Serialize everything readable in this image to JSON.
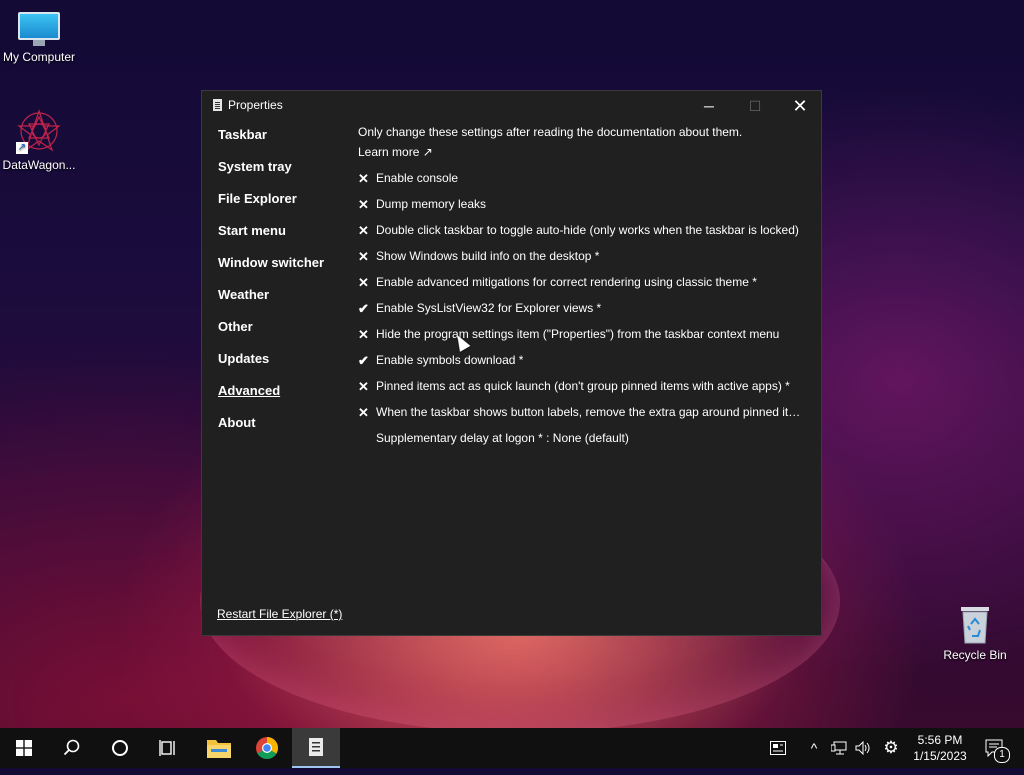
{
  "desktop": {
    "icons": [
      {
        "label": "My Computer"
      },
      {
        "label": "DataWagon..."
      },
      {
        "label": "Recycle Bin"
      }
    ]
  },
  "window": {
    "title": "Properties",
    "controls": {
      "minimize": "─",
      "maximize": "☐",
      "close": "✕"
    },
    "nav": [
      {
        "label": "Taskbar",
        "active": false
      },
      {
        "label": "System tray",
        "active": false
      },
      {
        "label": "File Explorer",
        "active": false
      },
      {
        "label": "Start menu",
        "active": false
      },
      {
        "label": "Window switcher",
        "active": false
      },
      {
        "label": "Weather",
        "active": false
      },
      {
        "label": "Other",
        "active": false
      },
      {
        "label": "Updates",
        "active": false
      },
      {
        "label": "Advanced",
        "active": true
      },
      {
        "label": "About",
        "active": false
      }
    ],
    "intro": "Only change these settings after reading the documentation about them.",
    "learn_more": "Learn more ↗",
    "options": [
      {
        "mark": "✕",
        "checked": false,
        "label": "Enable console"
      },
      {
        "mark": "✕",
        "checked": false,
        "label": "Dump memory leaks"
      },
      {
        "mark": "✕",
        "checked": false,
        "label": "Double click taskbar to toggle auto-hide (only works when the taskbar is locked)"
      },
      {
        "mark": "✕",
        "checked": false,
        "label": "Show Windows build info on the desktop *"
      },
      {
        "mark": "✕",
        "checked": false,
        "label": "Enable advanced mitigations for correct rendering using classic theme *"
      },
      {
        "mark": "✔",
        "checked": true,
        "label": "Enable SysListView32 for Explorer views *"
      },
      {
        "mark": "✕",
        "checked": false,
        "label": "Hide the program settings item (\"Properties\") from the taskbar context menu"
      },
      {
        "mark": "✔",
        "checked": true,
        "label": "Enable symbols download *"
      },
      {
        "mark": "✕",
        "checked": false,
        "label": "Pinned items act as quick launch (don't group pinned items with active apps) *"
      },
      {
        "mark": "✕",
        "checked": false,
        "label": "When the taskbar shows button labels, remove the extra gap around pinned ite..."
      },
      {
        "mark": "",
        "checked": false,
        "label": "Supplementary delay at logon * : None (default)"
      }
    ],
    "restart_link": "Restart File Explorer (*)"
  },
  "taskbar": {
    "start_icon": "windows-start-icon",
    "search_icon": "search-icon",
    "cortana_icon": "cortana-circle-icon",
    "taskview_icon": "task-view-icon",
    "pinned": [
      "file-explorer-icon",
      "chrome-icon",
      "properties-app-icon"
    ],
    "tray": {
      "chevron": "^",
      "network_icon": "network-icon",
      "volume_icon": "volume-icon",
      "settings_icon": "gear-icon",
      "notification_count": "1"
    },
    "time": "5:56 PM",
    "date": "1/15/2023"
  }
}
